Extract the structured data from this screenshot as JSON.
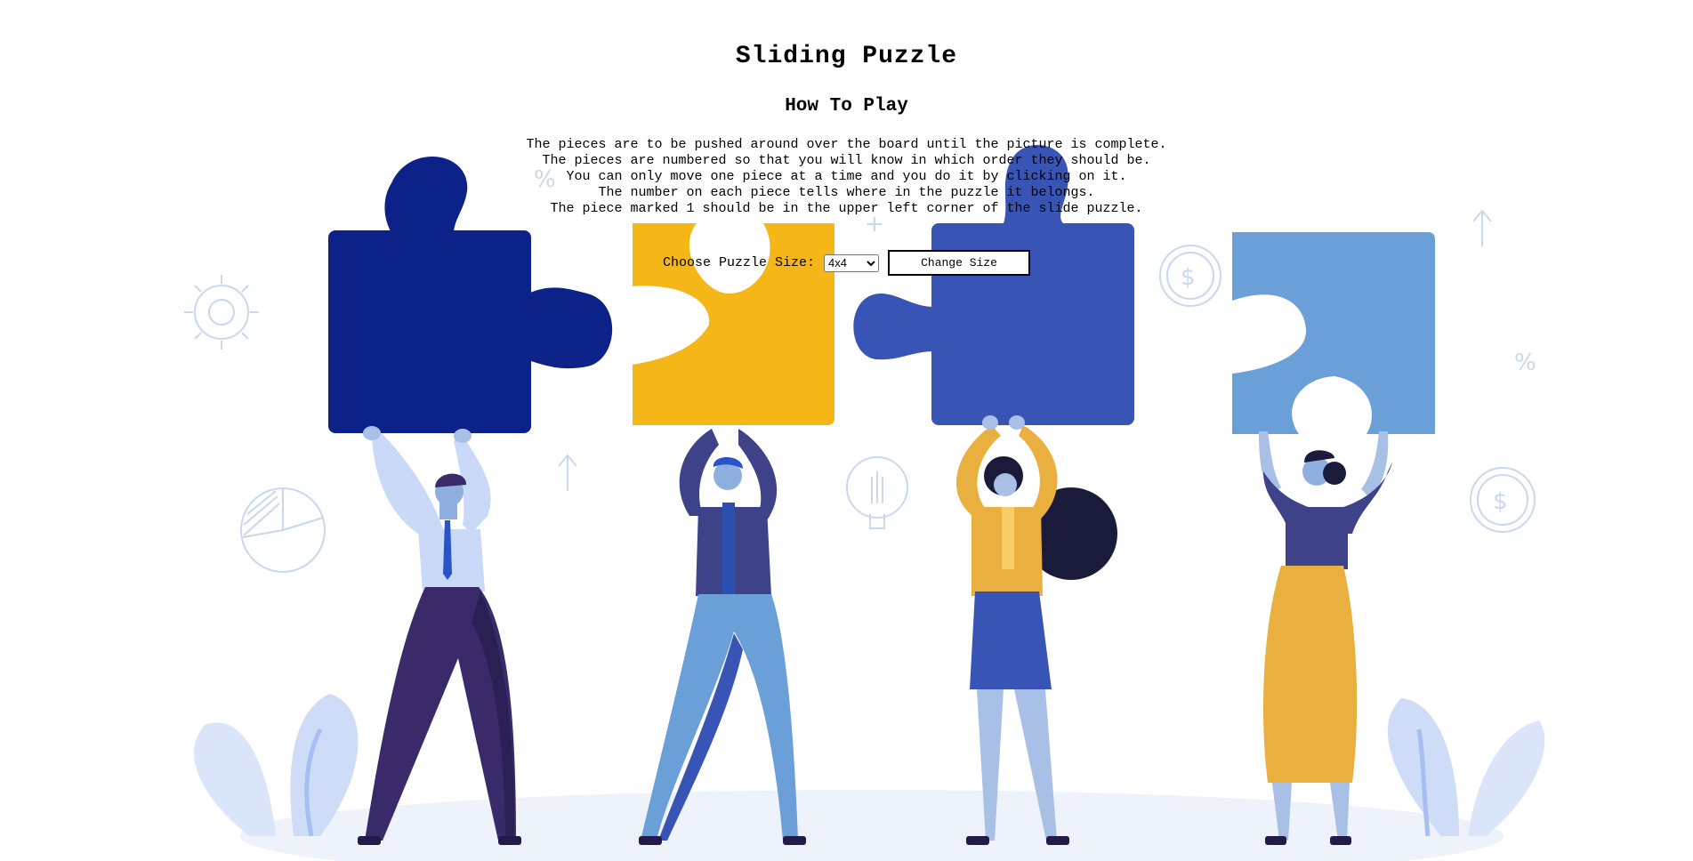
{
  "page": {
    "title": "Sliding Puzzle",
    "how_to_heading": "How To Play",
    "instructions": [
      "The pieces are to be pushed around over the board until the picture is complete.",
      "The pieces are numbered so that you will know in which order they should be.",
      "You can only move one piece at a time and you do it by clicking on it.",
      "The number on each piece tells where in the puzzle it belongs.",
      "The piece marked 1 should be in the upper left corner of the slide puzzle."
    ]
  },
  "controls": {
    "size_label": "Choose Puzzle Size:",
    "size_selected": "4x4",
    "change_size_label": "Change Size"
  },
  "illustration": {
    "decor_symbols": [
      "%",
      "%",
      "$",
      "$",
      "%",
      "+"
    ],
    "colors": {
      "navy": "#0d2288",
      "yellow": "#f5b717",
      "royal_blue": "#3855b5",
      "light_blue": "#6a9fd8",
      "purple": "#3b2a6a",
      "decor": "#c9d7ef"
    }
  }
}
